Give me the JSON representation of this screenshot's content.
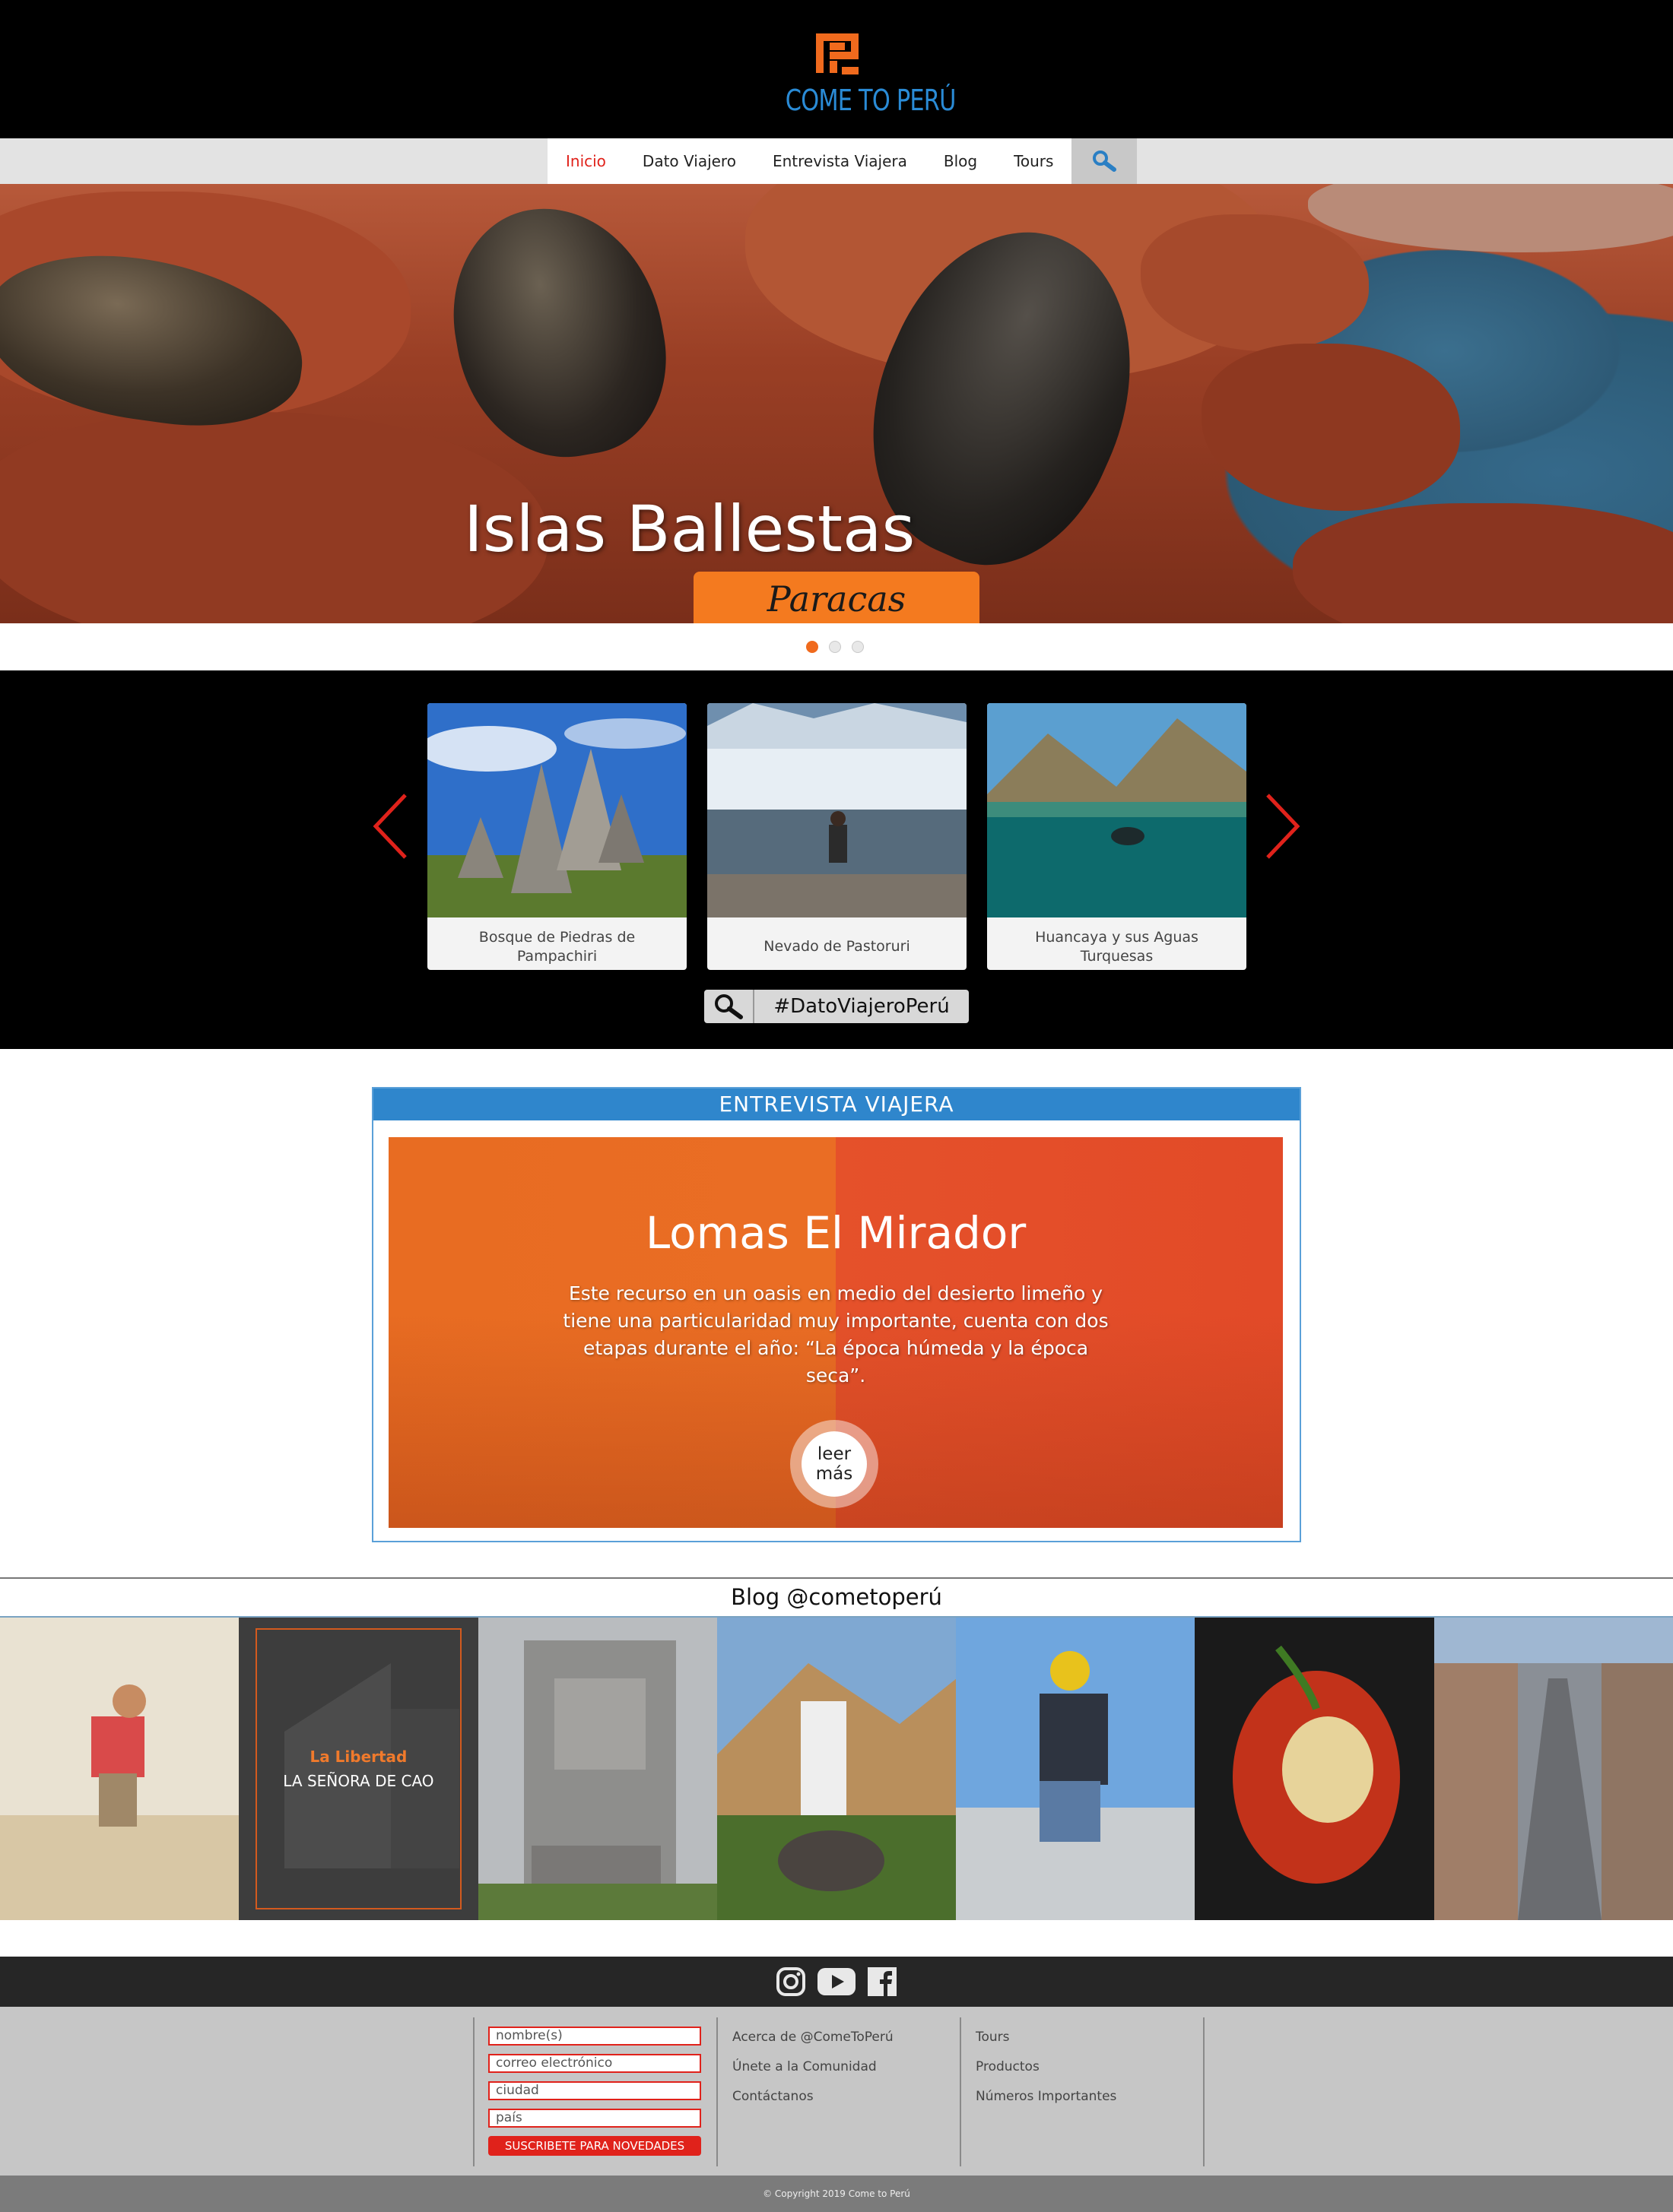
{
  "header": {
    "logo_text": "COME TO PERÚ",
    "brand_color": "#f06a1d",
    "accent_color": "#2a8bd6"
  },
  "nav": {
    "items": [
      {
        "label": "Inicio",
        "active": true
      },
      {
        "label": "Dato Viajero",
        "active": false
      },
      {
        "label": "Entrevista Viajera",
        "active": false
      },
      {
        "label": "Blog",
        "active": false
      },
      {
        "label": "Tours",
        "active": false
      }
    ],
    "search_icon": "search-icon"
  },
  "hero": {
    "title": "Islas Ballestas",
    "subtitle": "Paracas",
    "slide_count": 3,
    "active_slide": 1
  },
  "dato_viajero": {
    "cards": [
      {
        "label": "Bosque de Piedras de Pampachiri"
      },
      {
        "label": "Nevado de Pastoruri"
      },
      {
        "label": "Huancaya y sus Aguas Turquesas"
      }
    ],
    "hashtag": "#DatoViajeroPerú",
    "prev_icon": "chevron-left-icon",
    "next_icon": "chevron-right-icon"
  },
  "entrevista": {
    "heading": "ENTREVISTA VIAJERA",
    "title": "Lomas El Mirador",
    "text": "Este recurso en un oasis en medio del desierto limeño y tiene una particularidad muy importante, cuenta con dos etapas durante el año: “La época húmeda y la época seca”.",
    "button_line1": "leer",
    "button_line2": "más"
  },
  "blog": {
    "title": "Blog @cometoperú",
    "featured": {
      "region": "La Libertad",
      "name": "LA SEÑORA DE CAO"
    }
  },
  "footer": {
    "social_icons": [
      "instagram-icon",
      "youtube-icon",
      "facebook-icon"
    ],
    "form": {
      "placeholders": [
        "nombre(s)",
        "correo electrónico",
        "ciudad",
        "país"
      ],
      "button": "SUSCRIBETE PARA NOVEDADES"
    },
    "links_col1": [
      "Acerca de @ComeToPerú",
      "Únete a la Comunidad",
      "Contáctanos"
    ],
    "links_col2": [
      "Tours",
      "Productos",
      "Números Importantes"
    ],
    "copyright": "© Copyright 2019 Come to Perú"
  }
}
